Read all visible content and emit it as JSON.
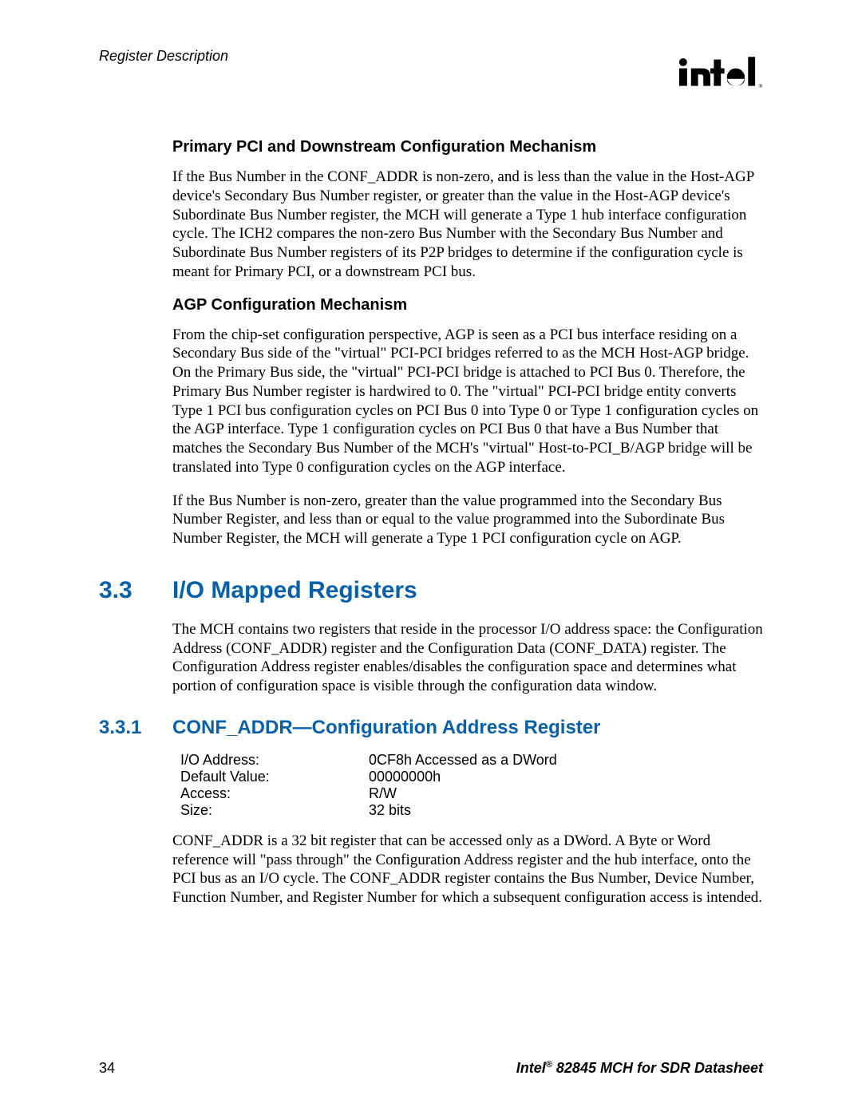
{
  "header": {
    "running_head": "Register Description"
  },
  "logo": {
    "alt": "intel",
    "reg_mark": "®"
  },
  "sections": {
    "s1": {
      "title": "Primary PCI and Downstream Configuration Mechanism",
      "p1": "If the Bus Number in the CONF_ADDR is non-zero, and is less than the value in the Host-AGP device's Secondary Bus Number register, or greater than the value in the Host-AGP device's Subordinate Bus Number register, the MCH will generate a Type 1 hub interface configuration cycle. The ICH2 compares the non-zero Bus Number with the Secondary Bus Number and Subordinate Bus Number registers of its P2P bridges to determine if the configuration cycle is meant for Primary PCI, or a downstream PCI bus."
    },
    "s2": {
      "title": "AGP Configuration Mechanism",
      "p1": "From the chip-set configuration perspective, AGP is seen as a PCI bus interface residing on a Secondary Bus side of the \"virtual\" PCI-PCI bridges referred to as the MCH Host-AGP bridge. On the Primary Bus side, the \"virtual\" PCI-PCI bridge is attached to PCI Bus 0. Therefore, the Primary Bus Number register is hardwired to 0. The \"virtual\" PCI-PCI bridge entity converts Type 1 PCI bus configuration cycles on PCI Bus 0 into Type 0 or Type 1 configuration cycles on the AGP interface. Type 1 configuration cycles on PCI Bus 0 that have a Bus Number that matches the Secondary Bus Number of the MCH's \"virtual\" Host-to-PCI_B/AGP bridge will be translated into Type 0 configuration cycles on the AGP interface.",
      "p2": "If the Bus Number is non-zero, greater than the value programmed into the Secondary Bus Number Register, and less than or equal to the value programmed into the Subordinate Bus Number Register, the MCH will generate a Type 1 PCI configuration cycle on AGP."
    },
    "h2": {
      "num": "3.3",
      "title": "I/O Mapped Registers",
      "p1": "The MCH contains two registers that reside in the processor I/O address space: the Configuration Address (CONF_ADDR) register and the Configuration Data (CONF_DATA) register. The Configuration Address register enables/disables the configuration space and determines what portion of configuration space is visible through the configuration data window."
    },
    "h3": {
      "num": "3.3.1",
      "title": "CONF_ADDR—Configuration Address Register",
      "kv": {
        "k0": "I/O Address:",
        "v0": "0CF8h Accessed as a DWord",
        "k1": "Default Value:",
        "v1": "00000000h",
        "k2": "Access:",
        "v2": "R/W",
        "k3": "Size:",
        "v3": "32 bits"
      },
      "p1": "CONF_ADDR is a 32 bit register that can be accessed only as a DWord. A Byte or Word reference will \"pass through\" the Configuration Address register and the hub interface, onto the PCI bus as an I/O cycle. The CONF_ADDR register contains the Bus Number, Device Number, Function Number, and Register Number for which a subsequent configuration access is intended."
    }
  },
  "footer": {
    "page_num": "34",
    "doc_prefix": "Intel",
    "reg_mark": "®",
    "doc_suffix": " 82845 MCH for SDR Datasheet"
  }
}
